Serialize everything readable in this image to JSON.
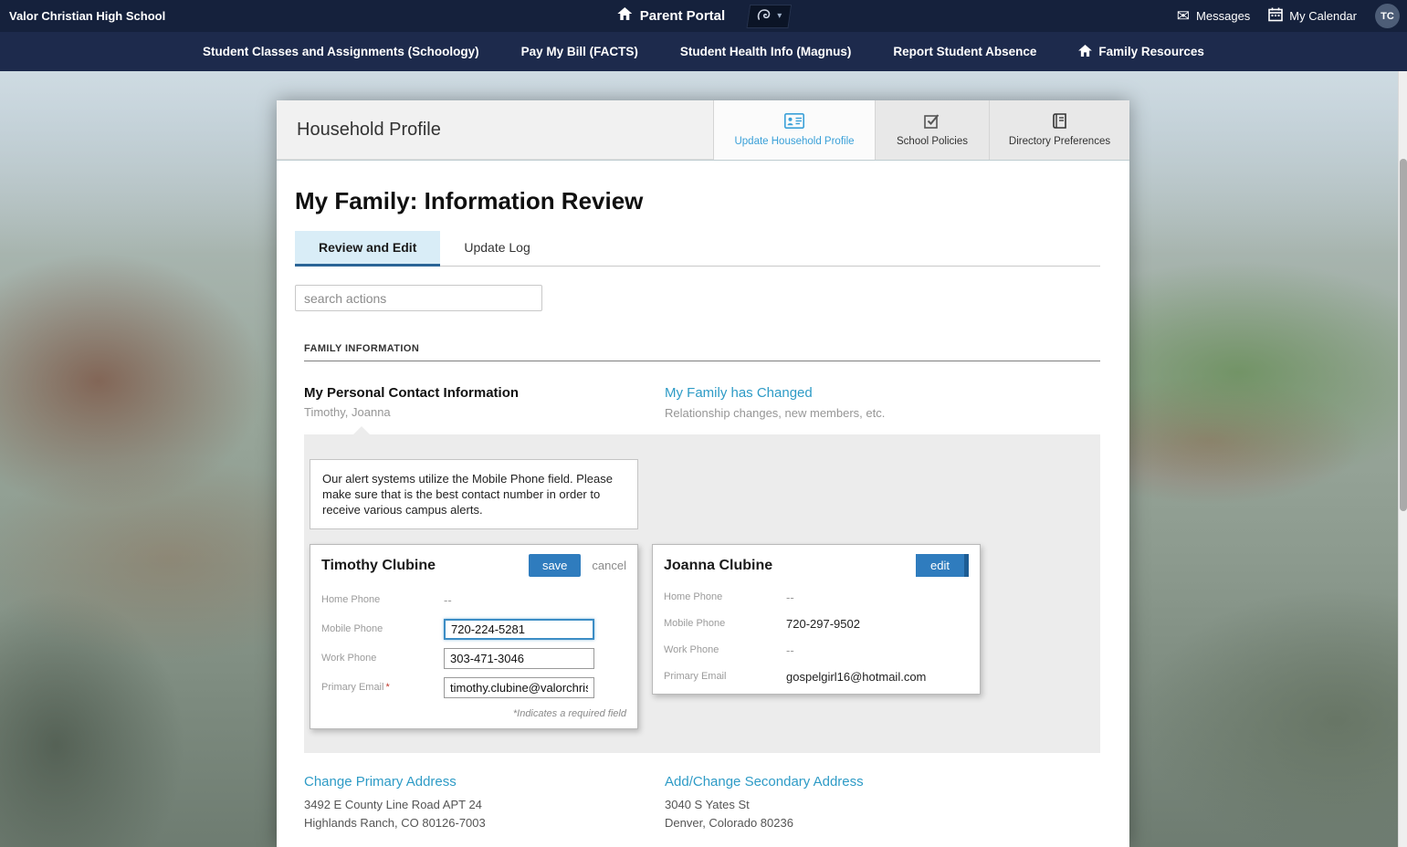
{
  "colors": {
    "navy_top_bar": "#15213c",
    "navy_nav_bar": "#1d2a4c",
    "link_blue": "#2e9bc6",
    "active_tab_blue": "#3aa0d8",
    "button_blue": "#2f7cbe",
    "active_subtab_bg": "#d9edf7"
  },
  "icons": {
    "messages": "✉",
    "dropdown_chevron": "▾"
  },
  "topbar": {
    "school_name": "Valor Christian High School",
    "portal_title": "Parent Portal",
    "messages_label": "Messages",
    "calendar_label": "My Calendar",
    "avatar_initials": "TC"
  },
  "nav": {
    "items": [
      {
        "label": "Student Classes and Assignments (Schoology)"
      },
      {
        "label": "Pay My Bill (FACTS)"
      },
      {
        "label": "Student Health Info (Magnus)"
      },
      {
        "label": "Report Student Absence"
      },
      {
        "label": "Family Resources"
      }
    ]
  },
  "profile": {
    "header_title": "Household Profile",
    "tabs": [
      {
        "label": "Update Household Profile",
        "active": true
      },
      {
        "label": "School Policies",
        "active": false
      },
      {
        "label": "Directory Preferences",
        "active": false
      }
    ]
  },
  "page": {
    "title": "My Family: Information Review",
    "subtabs": [
      {
        "label": "Review and Edit",
        "active": true
      },
      {
        "label": "Update Log",
        "active": false
      }
    ],
    "search_placeholder": "search actions",
    "section_title": "FAMILY INFORMATION"
  },
  "contact": {
    "title": "My Personal Contact Information",
    "subtitle": "Timothy, Joanna",
    "link": "My Family has Changed",
    "link_sub": "Relationship changes, new members, etc."
  },
  "panel": {
    "alert_text": "Our alert systems utilize the Mobile Phone field. Please make sure that is the best contact number in order to receive various campus alerts."
  },
  "field_labels": {
    "home": "Home Phone",
    "mobile": "Mobile Phone",
    "work": "Work Phone",
    "email": "Primary Email"
  },
  "persons": {
    "timothy": {
      "name": "Timothy Clubine",
      "save_label": "save",
      "cancel_label": "cancel",
      "home_value": "--",
      "mobile_value": "720-224-5281",
      "work_value": "303-471-3046",
      "email_value": "timothy.clubine@valorchrist",
      "required_mark": "*",
      "required_note": "*Indicates a required field"
    },
    "joanna": {
      "name": "Joanna Clubine",
      "edit_label": "edit",
      "home_value": "--",
      "mobile_value": "720-297-9502",
      "work_value": "--",
      "email_value": "gospelgirl16@hotmail.com"
    }
  },
  "addresses": {
    "primary": {
      "link": "Change Primary Address",
      "line1": "3492 E County Line Road APT 24",
      "line2": "Highlands Ranch, CO 80126-7003"
    },
    "secondary": {
      "link": "Add/Change Secondary Address",
      "line1": "3040 S Yates St",
      "line2": "Denver, Colorado 80236"
    }
  }
}
